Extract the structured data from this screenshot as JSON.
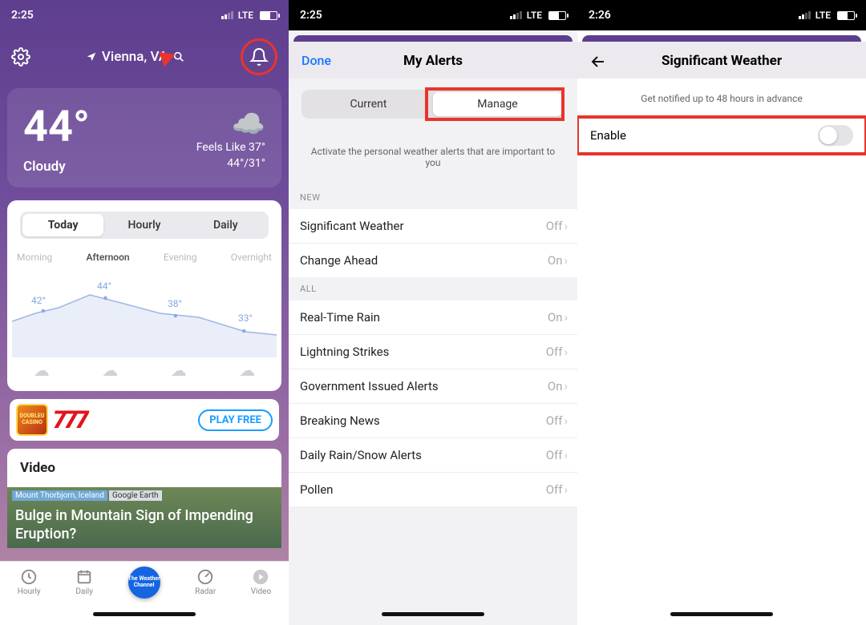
{
  "pane1": {
    "status": {
      "time": "2:25",
      "carrier": "LTE"
    },
    "location": "Vienna, VA",
    "temp": "44°",
    "condition": "Cloudy",
    "feels": "Feels Like 37°",
    "hilo": "44°/31°",
    "tabs": [
      "Today",
      "Hourly",
      "Daily"
    ],
    "dayparts": [
      "Morning",
      "Afternoon",
      "Evening",
      "Overnight"
    ],
    "ad_label": "PLAY FREE",
    "ad_slot": "777",
    "video_header": "Video",
    "video_tag1": "Mount Thorbjorn, Iceland",
    "video_tag2": "Google Earth",
    "video_title": "Bulge in Mountain Sign of Impending Eruption?",
    "tabbar": [
      "Hourly",
      "Daily",
      "",
      "Radar",
      "Video"
    ],
    "twc_text": "The Weather Channel"
  },
  "chart_data": {
    "type": "line",
    "categories": [
      "Morning",
      "Afternoon",
      "Evening",
      "Overnight"
    ],
    "values": [
      42,
      44,
      38,
      33
    ],
    "labels": [
      "42°",
      "44°",
      "38°",
      "33°"
    ],
    "ylim": [
      30,
      46
    ],
    "title": "",
    "xlabel": "",
    "ylabel": ""
  },
  "pane2": {
    "status": {
      "time": "2:25",
      "carrier": "LTE"
    },
    "done": "Done",
    "title": "My Alerts",
    "seg": [
      "Current",
      "Manage"
    ],
    "hint": "Activate the personal weather alerts that are important to you",
    "group_new": "NEW",
    "group_all": "ALL",
    "rows_new": [
      {
        "label": "Significant Weather",
        "value": "Off"
      },
      {
        "label": "Change Ahead",
        "value": "On"
      }
    ],
    "rows_all": [
      {
        "label": "Real-Time Rain",
        "value": "On"
      },
      {
        "label": "Lightning Strikes",
        "value": "Off"
      },
      {
        "label": "Government Issued Alerts",
        "value": "On"
      },
      {
        "label": "Breaking News",
        "value": "Off"
      },
      {
        "label": "Daily Rain/Snow Alerts",
        "value": "Off"
      },
      {
        "label": "Pollen",
        "value": "Off"
      }
    ]
  },
  "pane3": {
    "status": {
      "time": "2:26",
      "carrier": "LTE"
    },
    "title": "Significant Weather",
    "subtext": "Get notified up to 48 hours in advance",
    "enable": "Enable"
  }
}
